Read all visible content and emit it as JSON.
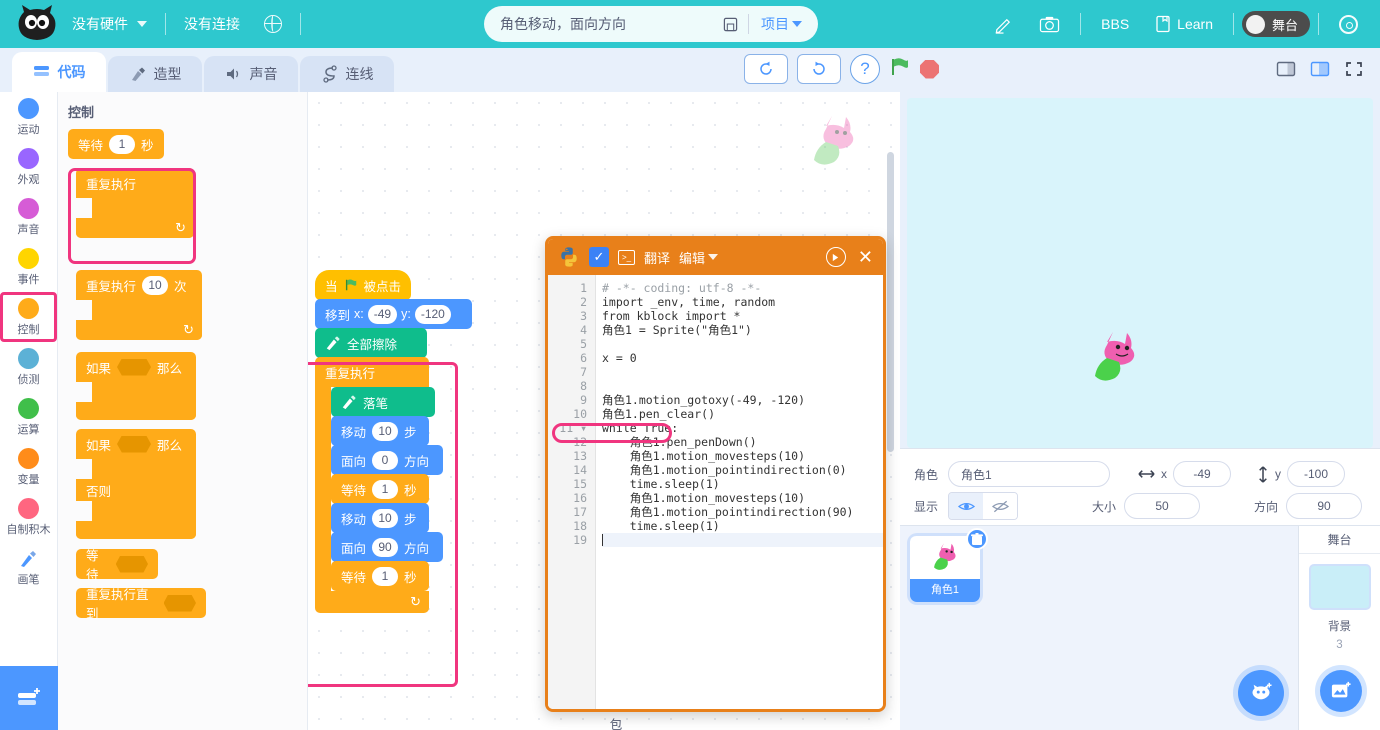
{
  "topbar": {
    "hardware_label": "没有硬件",
    "connection_label": "没有连接",
    "globe_icon": "globe-icon",
    "project_title": "角色移动，面向方向",
    "save_icon": "save-icon",
    "project_menu": "项目",
    "edit_icon": "pencil-icon",
    "camera_icon": "camera-icon",
    "bbs_label": "BBS",
    "learn_label": "Learn",
    "stage_toggle_label": "舞台",
    "settings_icon": "gear-icon"
  },
  "tabs": [
    {
      "label": "代码",
      "icon": "code-blocks-icon",
      "active": true
    },
    {
      "label": "造型",
      "icon": "paintbrush-icon",
      "active": false
    },
    {
      "label": "声音",
      "icon": "speaker-icon",
      "active": false
    },
    {
      "label": "连线",
      "icon": "wiring-icon",
      "active": false
    }
  ],
  "center_controls": {
    "undo_icon": "undo-icon",
    "redo_icon": "redo-icon",
    "help_label": "?",
    "green_flag_icon": "green-flag-icon",
    "stop_icon": "stop-icon"
  },
  "right_controls": {
    "small_stage_icon": "small-stage-icon",
    "large_stage_icon": "large-stage-icon",
    "fullscreen_icon": "fullscreen-icon"
  },
  "categories": [
    {
      "label": "运动",
      "color": "#4c97ff",
      "selected": false
    },
    {
      "label": "外观",
      "color": "#9966ff",
      "selected": false
    },
    {
      "label": "声音",
      "color": "#d65cd6",
      "selected": false
    },
    {
      "label": "事件",
      "color": "#ffd500",
      "selected": false
    },
    {
      "label": "控制",
      "color": "#ffab19",
      "selected": true
    },
    {
      "label": "侦测",
      "color": "#5cb1d6",
      "selected": false
    },
    {
      "label": "运算",
      "color": "#40bf4a",
      "selected": false
    },
    {
      "label": "变量",
      "color": "#ff8c1a",
      "selected": false
    },
    {
      "label": "自制积木",
      "color": "#ff6680",
      "selected": false
    },
    {
      "label": "画笔",
      "color": "#0fbd8c",
      "selected": false
    }
  ],
  "palette": {
    "title": "控制",
    "blocks": [
      {
        "name": "wait-seconds-block",
        "prefix": "等待",
        "value": "1",
        "suffix": "秒"
      },
      {
        "name": "forever-block",
        "prefix": "重复执行",
        "highlighted": true
      },
      {
        "name": "repeat-times-block",
        "prefix": "重复执行",
        "value": "10",
        "suffix": "次"
      },
      {
        "name": "if-then-block",
        "prefix": "如果",
        "suffix": "那么"
      },
      {
        "name": "if-else-block",
        "prefix": "如果",
        "suffix": "那么",
        "else_label": "否则"
      },
      {
        "name": "wait-until-block",
        "prefix": "等待"
      },
      {
        "name": "repeat-until-block",
        "prefix": "重复执行直到"
      }
    ]
  },
  "script": {
    "hat": {
      "prefix": "当",
      "suffix": "被点击",
      "flag_icon": "green-flag-icon"
    },
    "goto": {
      "prefix": "移到",
      "x_label": "x:",
      "x": "-49",
      "y_label": "y:",
      "y": "-120"
    },
    "erase_all": {
      "label": "全部擦除",
      "icon": "pen-icon"
    },
    "forever": {
      "label": "重复执行"
    },
    "inner": [
      {
        "name": "pen-down-block",
        "label": "落笔",
        "icon": "pen-icon"
      },
      {
        "name": "move-steps-block",
        "prefix": "移动",
        "value": "10",
        "suffix": "步"
      },
      {
        "name": "point-direction-block",
        "prefix": "面向",
        "value": "0",
        "suffix": "方向"
      },
      {
        "name": "wait-block",
        "prefix": "等待",
        "value": "1",
        "suffix": "秒"
      },
      {
        "name": "move-steps-block",
        "prefix": "移动",
        "value": "10",
        "suffix": "步"
      },
      {
        "name": "point-direction-block",
        "prefix": "面向",
        "value": "90",
        "suffix": "方向"
      },
      {
        "name": "wait-block",
        "prefix": "等待",
        "value": "1",
        "suffix": "秒"
      }
    ]
  },
  "backpack": {
    "label": "书包"
  },
  "python_editor": {
    "translate_label": "翻译",
    "edit_label": "编辑",
    "run_icon": "play-icon",
    "close_icon": "close-icon",
    "check_icon": "check-icon",
    "terminal_icon": "terminal-icon",
    "python_logo_icon": "python-logo-icon",
    "highlight_line": 11,
    "lines": [
      {
        "n": 1,
        "text": "# -*- coding: utf-8 -*-"
      },
      {
        "n": 2,
        "text": "import _env, time, random"
      },
      {
        "n": 3,
        "text": "from kblock import *"
      },
      {
        "n": 4,
        "text": "角色1 = Sprite(\"角色1\")"
      },
      {
        "n": 5,
        "text": ""
      },
      {
        "n": 6,
        "text": "x = 0"
      },
      {
        "n": 7,
        "text": ""
      },
      {
        "n": 8,
        "text": ""
      },
      {
        "n": 9,
        "text": "角色1.motion_gotoxy(-49, -120)"
      },
      {
        "n": 10,
        "text": "角色1.pen_clear()"
      },
      {
        "n": 11,
        "text": "while True:"
      },
      {
        "n": 12,
        "text": "    角色1.pen_penDown()"
      },
      {
        "n": 13,
        "text": "    角色1.motion_movesteps(10)"
      },
      {
        "n": 14,
        "text": "    角色1.motion_pointindirection(0)"
      },
      {
        "n": 15,
        "text": "    time.sleep(1)"
      },
      {
        "n": 16,
        "text": "    角色1.motion_movesteps(10)"
      },
      {
        "n": 17,
        "text": "    角色1.motion_pointindirection(90)"
      },
      {
        "n": 18,
        "text": "    time.sleep(1)"
      },
      {
        "n": 19,
        "text": ""
      }
    ]
  },
  "sprite_info": {
    "sprite_label": "角色",
    "sprite_name": "角色1",
    "x_label": "x",
    "x_value": "-49",
    "y_label": "y",
    "y_value": "-100",
    "show_label": "显示",
    "show_icon": "eye-icon",
    "hide_icon": "eye-slash-icon",
    "size_label": "大小",
    "size_value": "50",
    "direction_label": "方向",
    "direction_value": "90"
  },
  "sprite_list": {
    "items": [
      {
        "name": "角色1",
        "selected": true,
        "delete_icon": "trash-icon"
      }
    ],
    "add_sprite_icon": "add-sprite-icon"
  },
  "stage_panel": {
    "header": "舞台",
    "backdrop_label": "背景",
    "backdrop_count": "3",
    "add_backdrop_icon": "add-backdrop-icon"
  },
  "colors": {
    "brand_teal": "#2ec8ce",
    "accent_blue": "#4c97ff",
    "highlight_pink": "#f0357f",
    "control_orange": "#ffab19",
    "pen_green": "#0fbd8c",
    "editor_orange": "#e8801a"
  }
}
